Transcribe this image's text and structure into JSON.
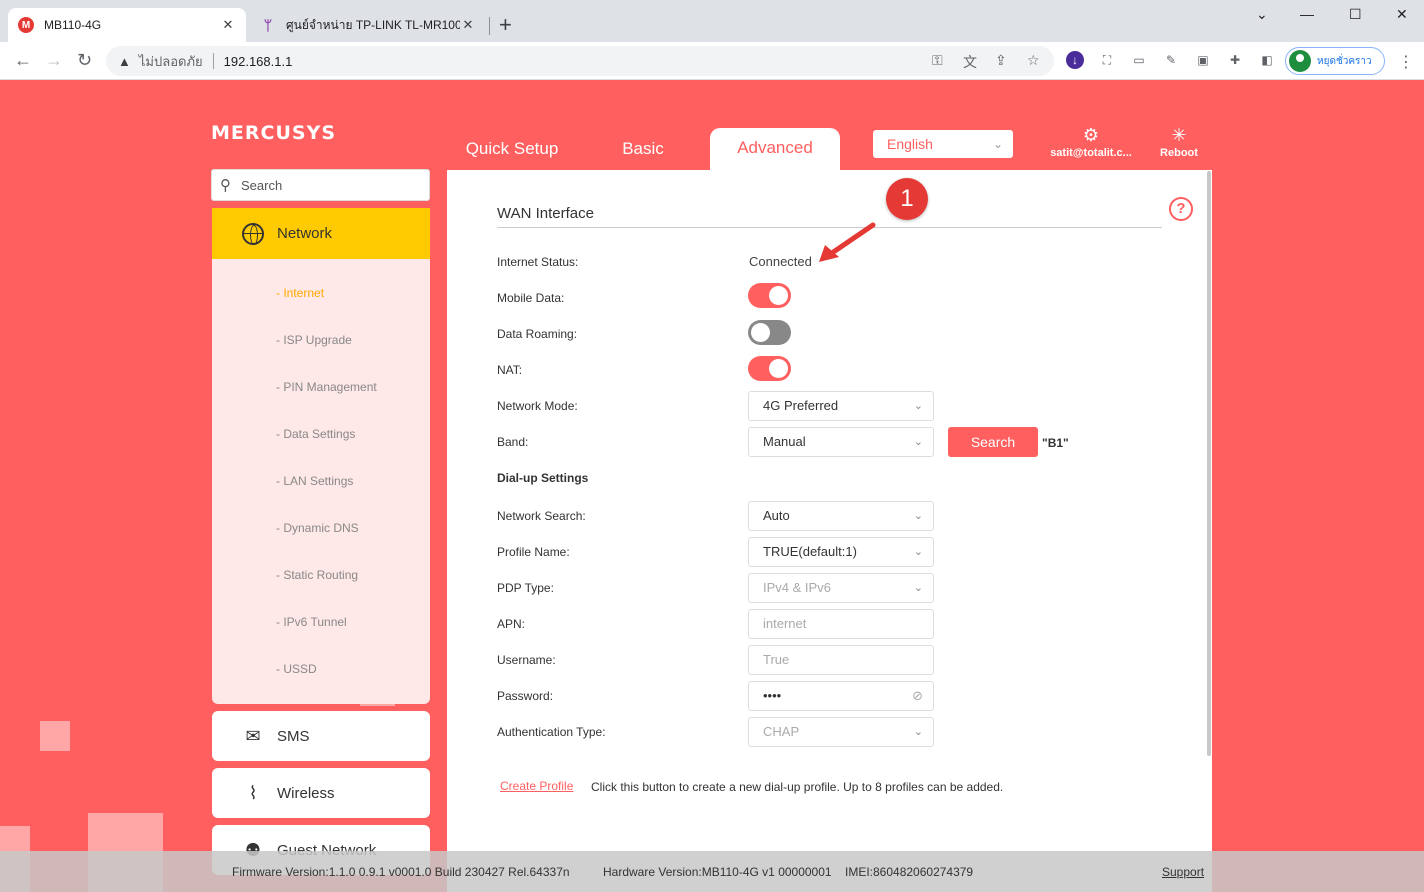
{
  "browser": {
    "tabs": [
      {
        "title": "MB110-4G",
        "favicon_letter": "M"
      },
      {
        "title": "ศูนย์จำหน่าย TP-LINK TL-MR100 3G"
      }
    ],
    "new_tab_label": "+",
    "window_controls": {
      "minimize": "⌄",
      "restore": "—",
      "maximize": "☐",
      "close": "✕"
    },
    "address": {
      "security_label": "ไม่ปลอดภัย",
      "url": "192.168.1.1"
    },
    "profile_label": "หยุดชั่วคราว",
    "extension_icons": [
      "download-icon",
      "screenshot-icon",
      "cast-icon",
      "edit-icon",
      "capture-icon",
      "puzzle-icon",
      "sidepanel-icon"
    ]
  },
  "router": {
    "logo": "MERCUSYS",
    "nav_tabs": [
      {
        "label": "Quick Setup",
        "active": false
      },
      {
        "label": "Basic",
        "active": false
      },
      {
        "label": "Advanced",
        "active": true
      }
    ],
    "language": "English",
    "user_label": "satit@totalit.c...",
    "reboot_label": "Reboot",
    "search_placeholder": "Search",
    "sidebar": {
      "network_label": "Network",
      "network_items": [
        {
          "label": "- Internet",
          "active": true
        },
        {
          "label": "- ISP Upgrade"
        },
        {
          "label": "- PIN Management"
        },
        {
          "label": "- Data Settings"
        },
        {
          "label": "- LAN Settings"
        },
        {
          "label": "- Dynamic DNS"
        },
        {
          "label": "- Static Routing"
        },
        {
          "label": "- IPv6 Tunnel"
        },
        {
          "label": "- USSD"
        }
      ],
      "sms_label": "SMS",
      "wireless_label": "Wireless",
      "guest_label": "Guest Network"
    },
    "wan": {
      "title": "WAN Interface",
      "internet_status_label": "Internet Status:",
      "internet_status_value": "Connected",
      "mobile_data_label": "Mobile Data:",
      "mobile_data_on": true,
      "data_roaming_label": "Data Roaming:",
      "data_roaming_on": false,
      "nat_label": "NAT:",
      "nat_on": true,
      "network_mode_label": "Network Mode:",
      "network_mode_value": "4G Preferred",
      "band_label": "Band:",
      "band_value": "Manual",
      "search_button": "Search",
      "band_note": "\"B1\"",
      "dialup_title": "Dial-up Settings",
      "network_search_label": "Network Search:",
      "network_search_value": "Auto",
      "profile_name_label": "Profile Name:",
      "profile_name_value": "TRUE(default:1)",
      "pdp_type_label": "PDP Type:",
      "pdp_type_value": "IPv4 & IPv6",
      "apn_label": "APN:",
      "apn_value": "internet",
      "username_label": "Username:",
      "username_value": "True",
      "password_label": "Password:",
      "password_value": "••••",
      "auth_type_label": "Authentication Type:",
      "auth_type_value": "CHAP",
      "create_profile_label": "Create Profile",
      "create_profile_note": "Click this button to create a new dial-up profile. Up to 8 profiles can be added."
    },
    "annotation_number": "1",
    "footer": {
      "firmware": "Firmware Version:1.1.0 0.9.1 v0001.0 Build 230427 Rel.64337n",
      "hardware": "Hardware Version:MB110-4G v1 00000001",
      "imei": "IMEI:860482060274379",
      "support": "Support"
    }
  },
  "colors": {
    "brand": "#ff5f5f",
    "accent_yellow": "#ffcb00",
    "chrome_bg": "#dee1e6"
  }
}
